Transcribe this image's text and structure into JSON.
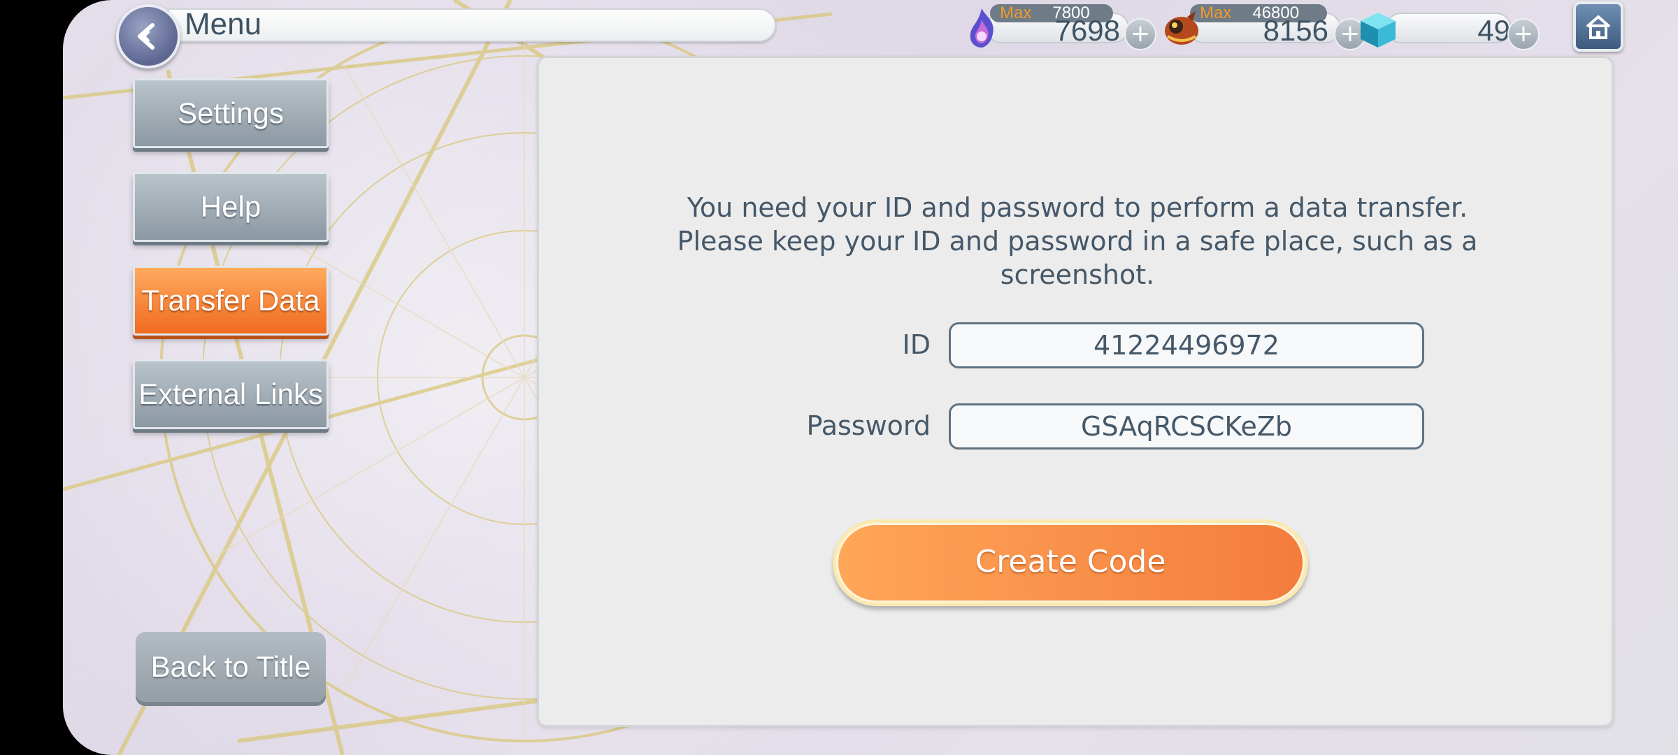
{
  "header": {
    "title": "Menu",
    "resources": [
      {
        "icon": "flame-stamina-icon",
        "max_label": "Max",
        "max_value": "7800",
        "value": "7698"
      },
      {
        "icon": "beast-gold-icon",
        "max_label": "Max",
        "max_value": "46800",
        "value": "8156"
      },
      {
        "icon": "crystal-cube-icon",
        "value": "49"
      }
    ],
    "plus": "+"
  },
  "sidebar": {
    "items": [
      {
        "label": "Settings",
        "active": false
      },
      {
        "label": "Help",
        "active": false
      },
      {
        "label": "Transfer Data",
        "active": true
      },
      {
        "label": "External Links",
        "active": false
      }
    ],
    "back_to_title": "Back to Title"
  },
  "panel": {
    "info_lines": [
      "You need your ID and password to perform a data transfer.",
      "Please keep your ID and password in a safe place, such as a",
      "screenshot."
    ],
    "id_label": "ID",
    "id_value": "41224496972",
    "password_label": "Password",
    "password_value": "GSAqRCSCKeZb",
    "create_button": "Create Code"
  },
  "colors": {
    "active_orange": "#f47c3c",
    "text_slate": "#455869",
    "accent_gold": "#f19a2a"
  }
}
